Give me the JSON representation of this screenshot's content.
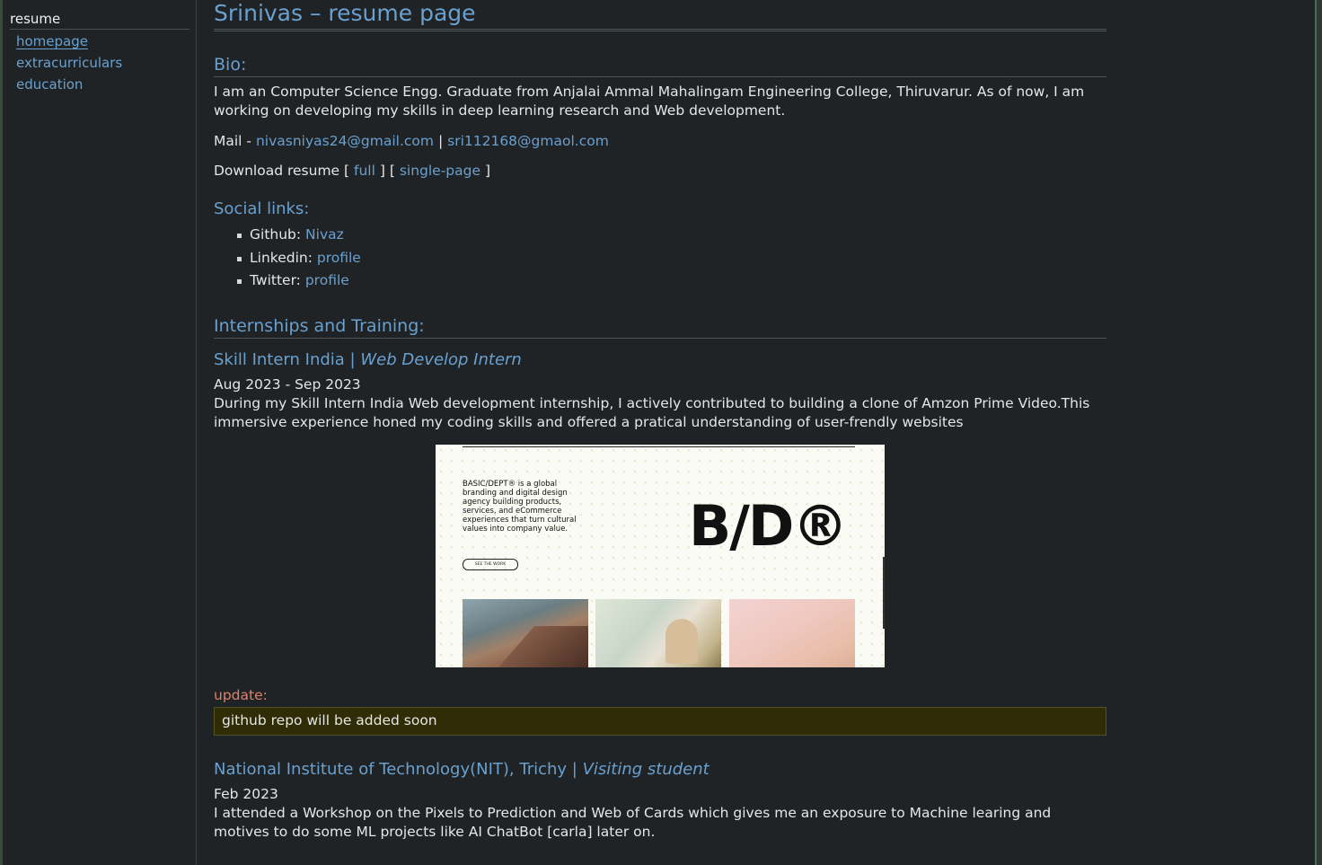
{
  "sidebar": {
    "title": "resume",
    "links": [
      {
        "label": "homepage"
      },
      {
        "label": "extracurriculars"
      },
      {
        "label": "education"
      }
    ]
  },
  "page": {
    "title": "Srinivas – resume page"
  },
  "bio": {
    "heading": "Bio:",
    "text": "I am an Computer Science Engg. Graduate from Anjalai Ammal Mahalingam Engineering College, Thiruvarur. As of now, I am working on developing my skills in deep learning research and Web development.",
    "mail_prefix": "Mail -",
    "email1": "nivasniyas24@gmail.com",
    "separator": "|",
    "email2": "sri112168@gmaol.com",
    "download_prefix": "Download resume [",
    "download_full": "full",
    "download_mid": "] [",
    "download_single": "single-page",
    "download_suffix": "]"
  },
  "social": {
    "heading": "Social links:",
    "items": [
      {
        "label": "Github:",
        "link": "Nivaz"
      },
      {
        "label": "Linkedin:",
        "link": "profile"
      },
      {
        "label": "Twitter:",
        "link": "profile"
      }
    ]
  },
  "internships": {
    "heading": "Internships and Training:",
    "entries": [
      {
        "org": "Skill Intern India |",
        "role": "Web Develop Intern",
        "date": "Aug 2023 - Sep 2023",
        "description": "During my Skill Intern India Web development internship, I actively contributed to building a clone of Amzon Prime Video.This immersive experience honed my coding skills and offered a pratical understanding of user-frendly websites"
      },
      {
        "org": "National Institute of Technology(NIT), Trichy |",
        "role": "Visiting student",
        "date": "Feb 2023",
        "description": "I attended a Workshop on the Pixels to Prediction and Web of Cards which gives me an exposure to Machine learing and motives to do some ML projects like AI ChatBot [carla] later on."
      }
    ]
  },
  "screenshot": {
    "text": "BASIC/DEPT® is a global branding and digital design agency building products, services, and eCommerce experiences that turn cultural values into company value.",
    "button": "SEE THE WORK",
    "logo": "B/D®"
  },
  "update": {
    "label": "update:",
    "text": "github repo will be added soon"
  }
}
